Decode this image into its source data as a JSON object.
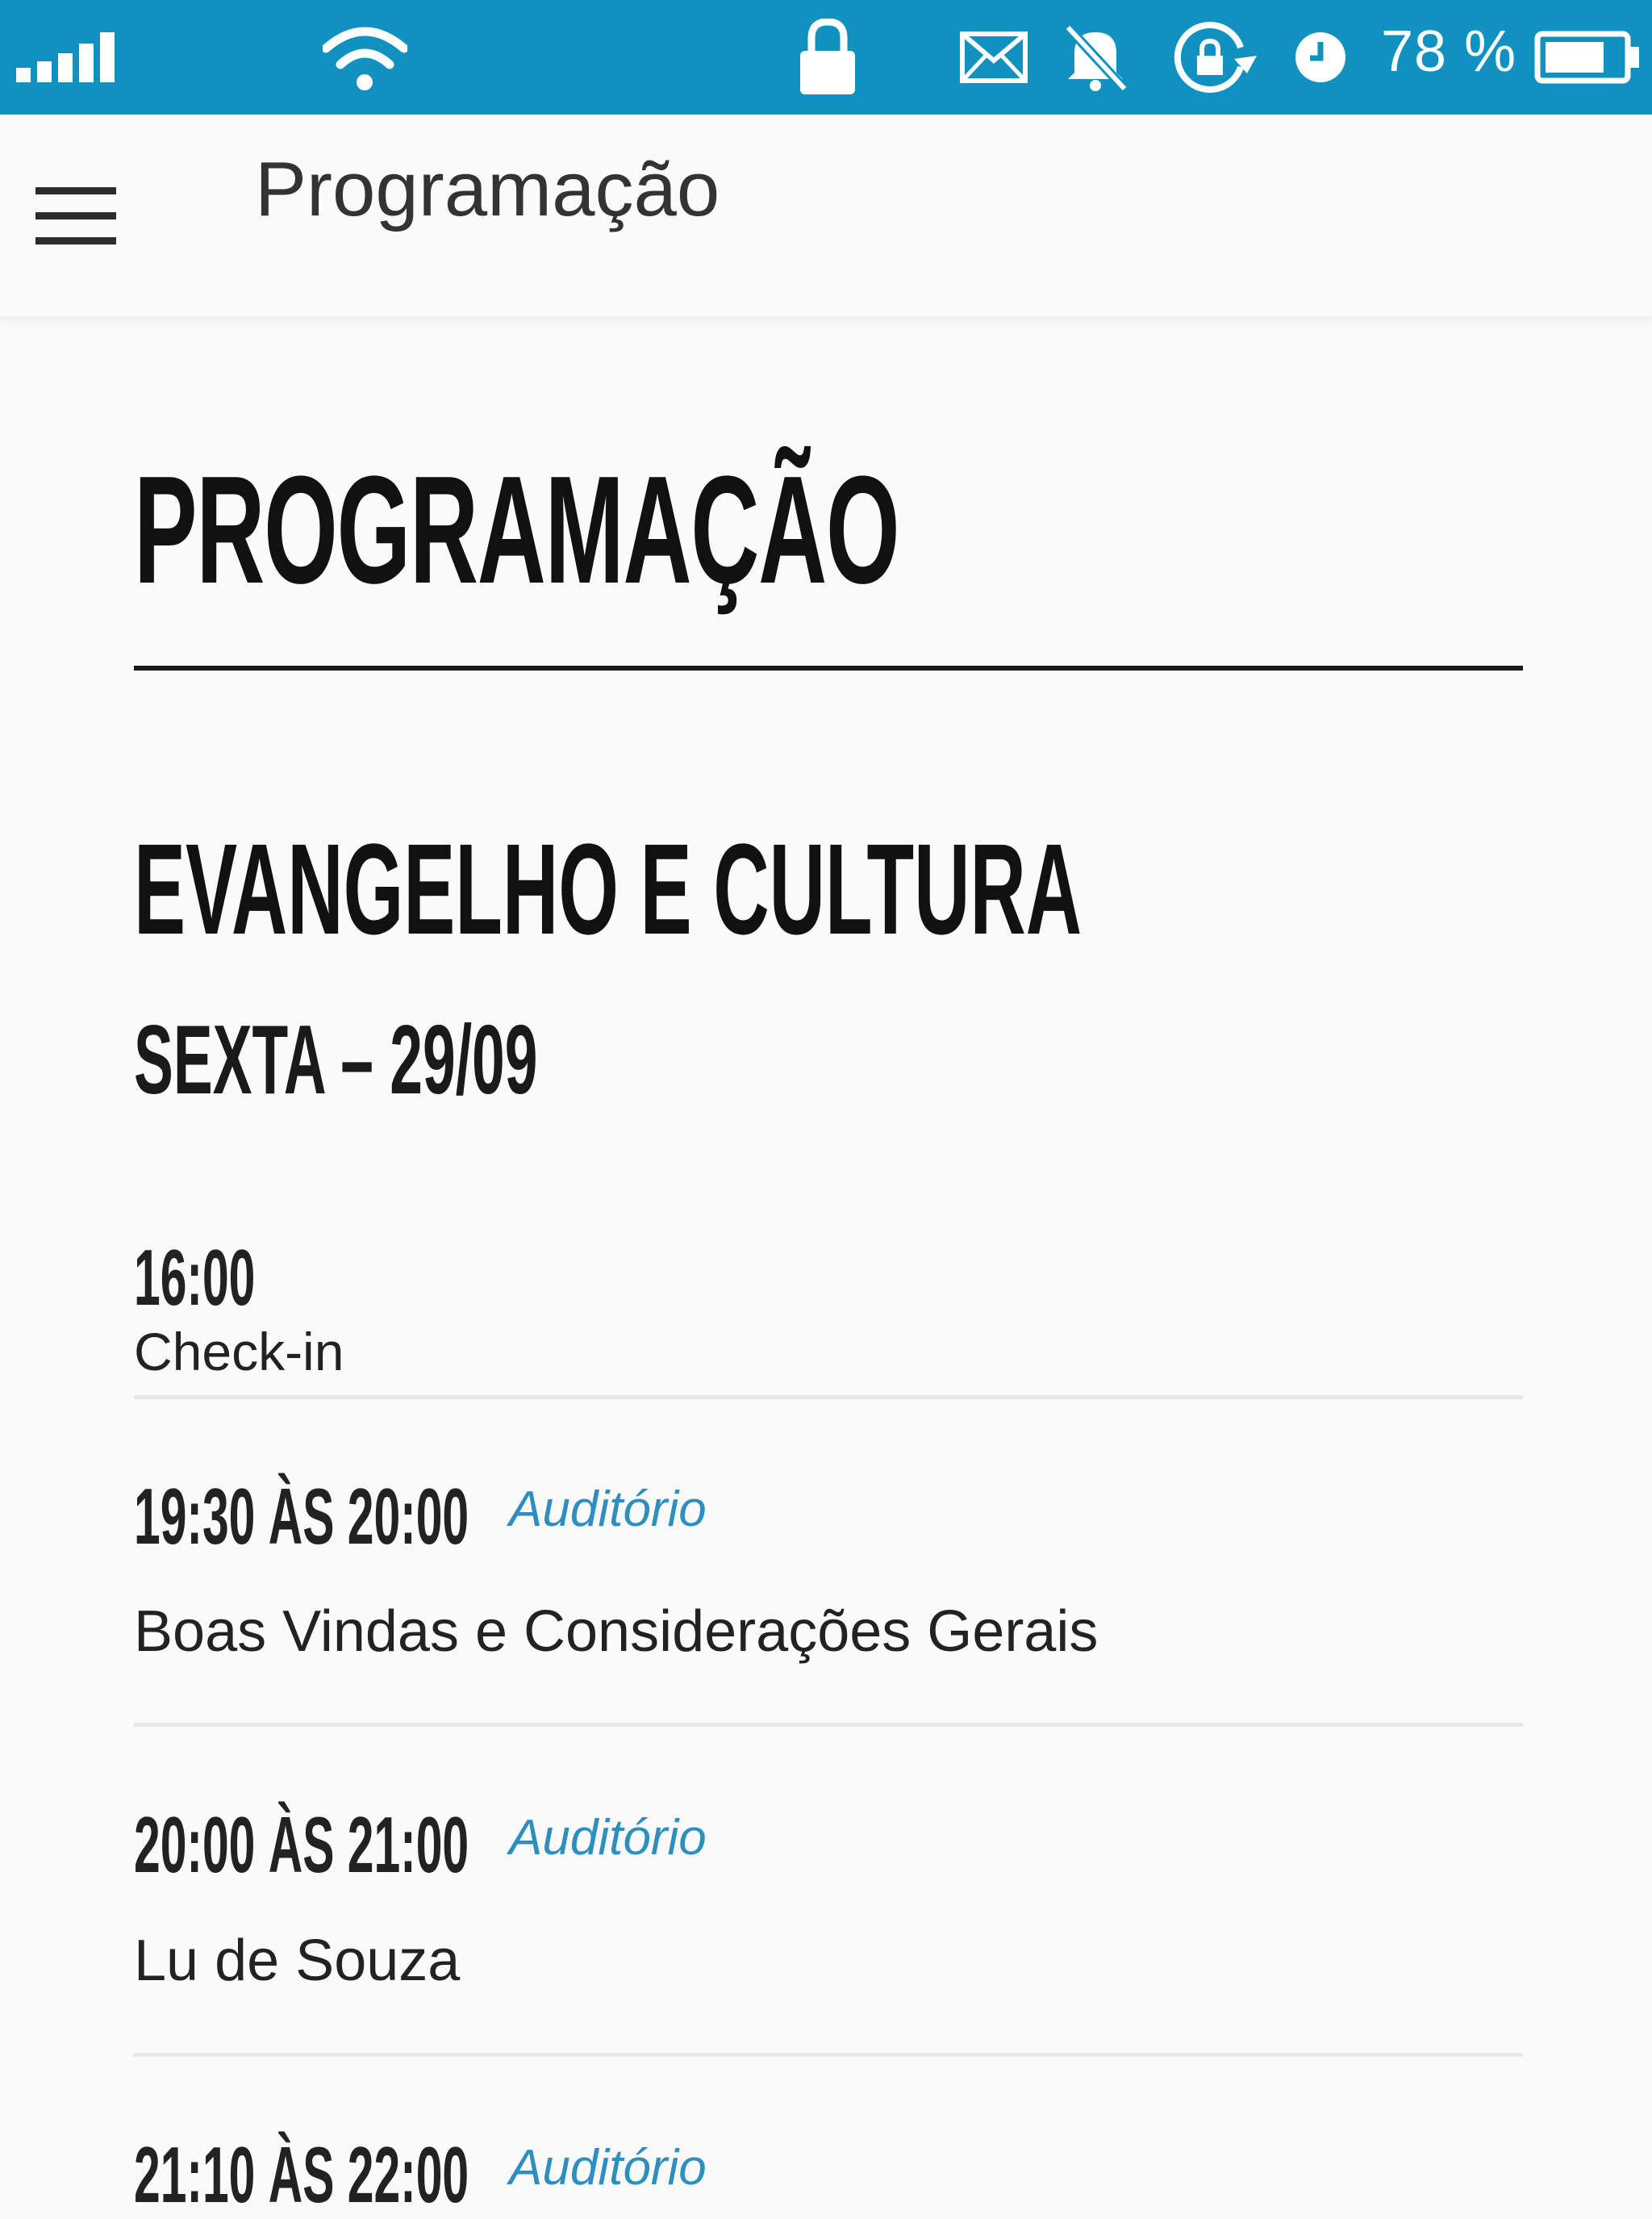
{
  "status_bar": {
    "battery_percent": "78 %",
    "icons": [
      "signal-icon",
      "wifi-icon",
      "lock-icon",
      "mail-icon",
      "notifications-off-icon",
      "screen-rotation-lock-icon",
      "clock-icon",
      "battery-icon"
    ],
    "battery_level": 0.78
  },
  "app_bar": {
    "title": "Programação",
    "menu_icon": "menu-icon"
  },
  "page": {
    "heading": "PROGRAMAÇÃO",
    "event_title": "EVANGELHO E CULTURA",
    "day_title": "SEXTA – 29/09"
  },
  "schedule": [
    {
      "time": "16:00",
      "location": "",
      "text": "Check-in"
    },
    {
      "time": "19:30 ÀS 20:00",
      "location": "Auditório",
      "text": "Boas Vindas e Considerações Gerais"
    },
    {
      "time": "20:00 ÀS 21:00",
      "location": "Auditório",
      "text": "Lu de Souza"
    },
    {
      "time": "21:10 ÀS 22:00",
      "location": "Auditório",
      "text": ""
    }
  ],
  "colors": {
    "status_bar": "#1191bf",
    "accent": "#2d8fc0",
    "background": "#fafafa"
  }
}
